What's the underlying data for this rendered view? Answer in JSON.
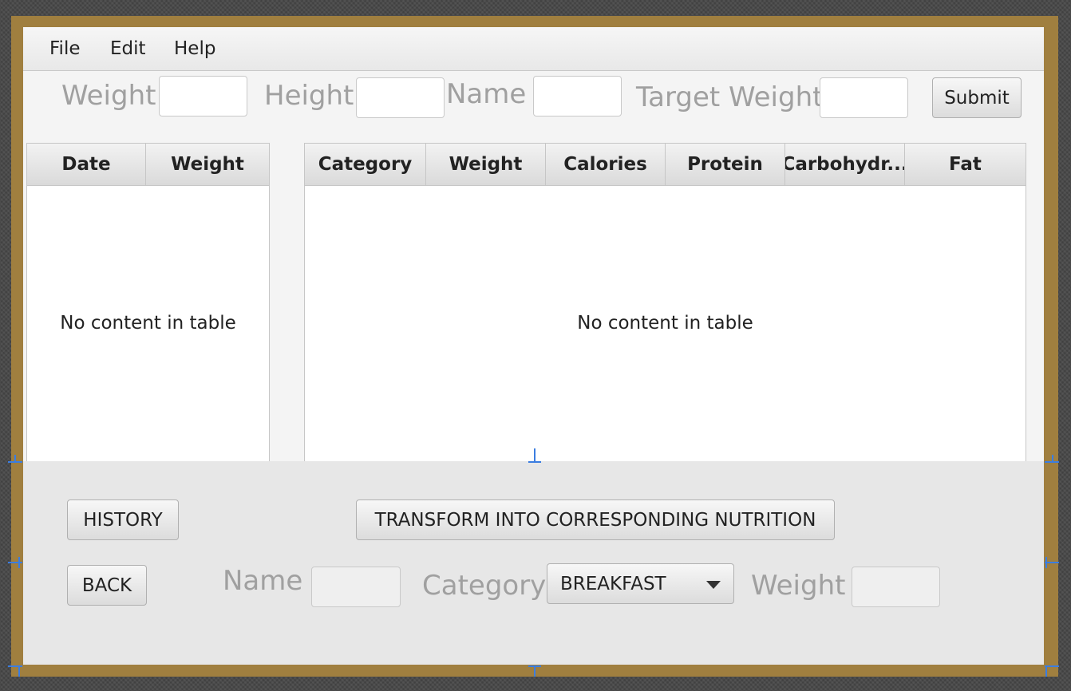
{
  "menu": {
    "file": "File",
    "edit": "Edit",
    "help": "Help"
  },
  "top_form": {
    "weight_label": "Weight",
    "height_label": "Height",
    "name_label": "Name",
    "target_weight_label": "Target Weight",
    "submit_label": "Submit"
  },
  "history_table": {
    "columns": [
      "Date",
      "Weight"
    ],
    "empty_text": "No content in table"
  },
  "nutrition_table": {
    "columns": [
      "Category",
      "Weight",
      "Calories",
      "Protein",
      "Carbohydr...",
      "Fat"
    ],
    "empty_text": "No content in table"
  },
  "bottom_form": {
    "history_button": "HISTORY",
    "transform_button": "TRANSFORM INTO CORRESPONDING NUTRITION",
    "back_button": "BACK",
    "name_label": "Name",
    "category_label": "Category",
    "category_selected": "BREAKFAST",
    "weight_label": "Weight"
  },
  "colors": {
    "frame": "#a07f3f",
    "window": "#f4f4f4",
    "guide_marker": "#3b7de0"
  }
}
